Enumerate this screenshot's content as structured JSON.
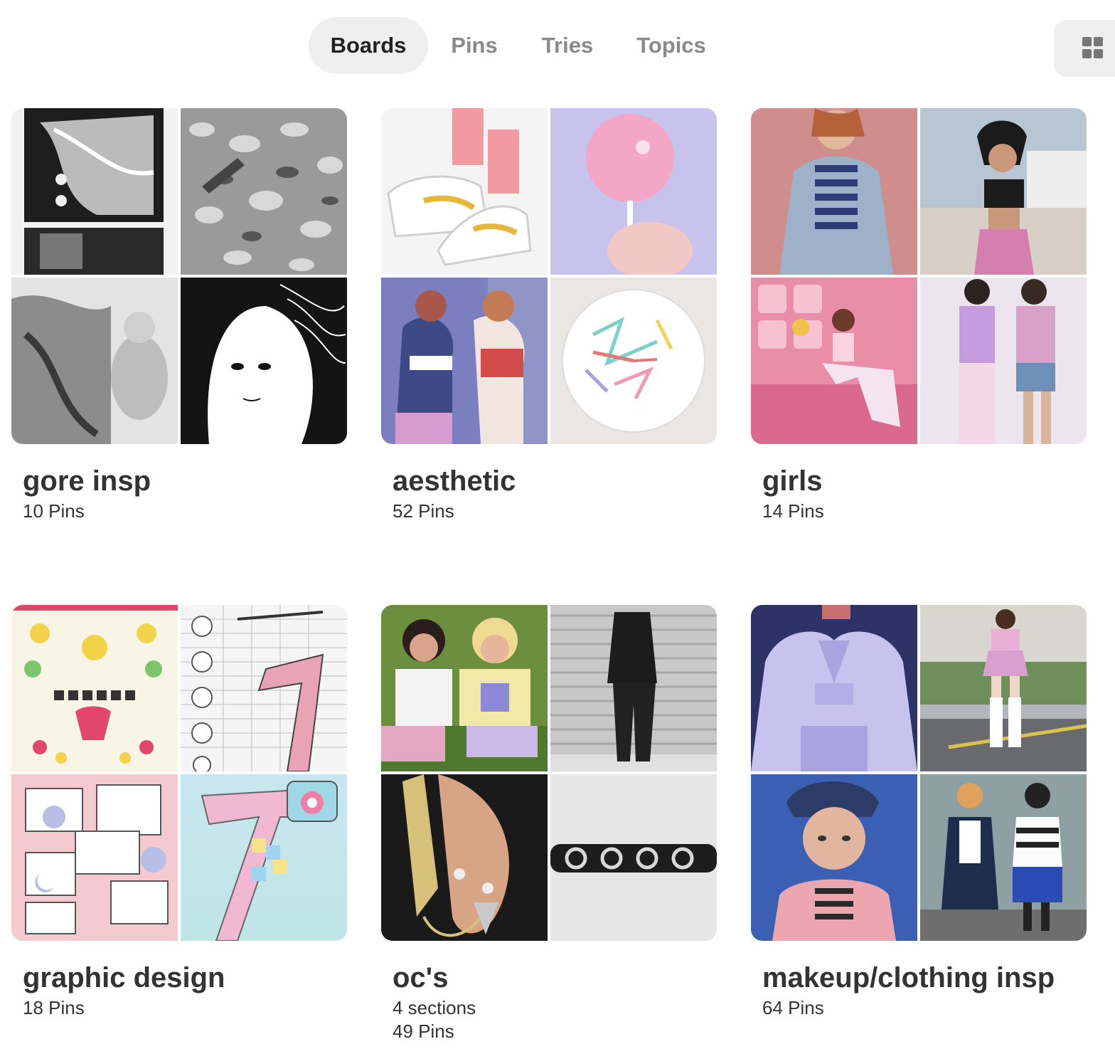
{
  "tabs": [
    {
      "label": "Boards",
      "active": true
    },
    {
      "label": "Pins",
      "active": false
    },
    {
      "label": "Tries",
      "active": false
    },
    {
      "label": "Topics",
      "active": false
    }
  ],
  "layout_button": {
    "icon": "grid-icon"
  },
  "boards": [
    {
      "title": "gore insp",
      "pins": "10 Pins"
    },
    {
      "title": "aesthetic",
      "pins": "52 Pins"
    },
    {
      "title": "girls",
      "pins": "14 Pins"
    },
    {
      "title": "graphic design",
      "pins": "18 Pins"
    },
    {
      "title": "oc's",
      "sections": "4 sections",
      "pins": "49 Pins"
    },
    {
      "title": "makeup/clothing insp",
      "pins": "64 Pins"
    }
  ]
}
